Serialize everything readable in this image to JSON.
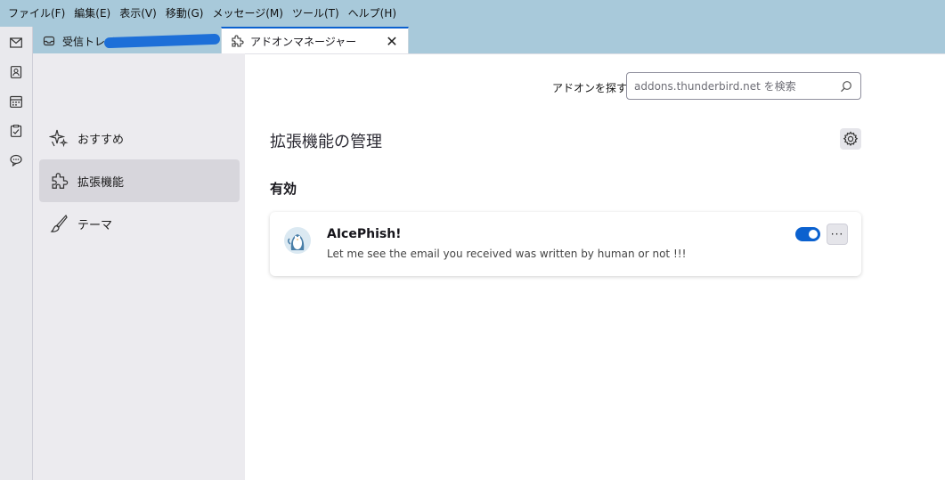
{
  "menubar": {
    "items": [
      "ファイル(F)",
      "編集(E)",
      "表示(V)",
      "移動(G)",
      "メッセージ(M)",
      "ツール(T)",
      "ヘルプ(H)"
    ]
  },
  "tabs": {
    "inbox_label": "受信トレイ",
    "addons_label": "アドオンマネージャー",
    "close_glyph": "✕"
  },
  "spaces": [
    "mail-icon",
    "address-book-icon",
    "calendar-icon",
    "tasks-icon",
    "chat-icon"
  ],
  "categories": [
    {
      "label": "おすすめ",
      "icon": "sparkle-icon",
      "selected": false
    },
    {
      "label": "拡張機能",
      "icon": "puzzle-icon",
      "selected": true
    },
    {
      "label": "テーマ",
      "icon": "brush-icon",
      "selected": false
    }
  ],
  "search": {
    "label": "アドオンを探す",
    "placeholder": "addons.thunderbird.net を検索"
  },
  "main": {
    "title": "拡張機能の管理",
    "section_enabled": "有効"
  },
  "addon": {
    "name": "AIcePhish!",
    "description": "Let me see the email you received was written by human or not !!!",
    "enabled": true,
    "more_glyph": "···"
  },
  "colors": {
    "accent": "#0b61cf",
    "menubar_bg": "#a8c9da",
    "sidebar_bg": "#ecebef",
    "selected_bg": "#d7d6dc"
  }
}
